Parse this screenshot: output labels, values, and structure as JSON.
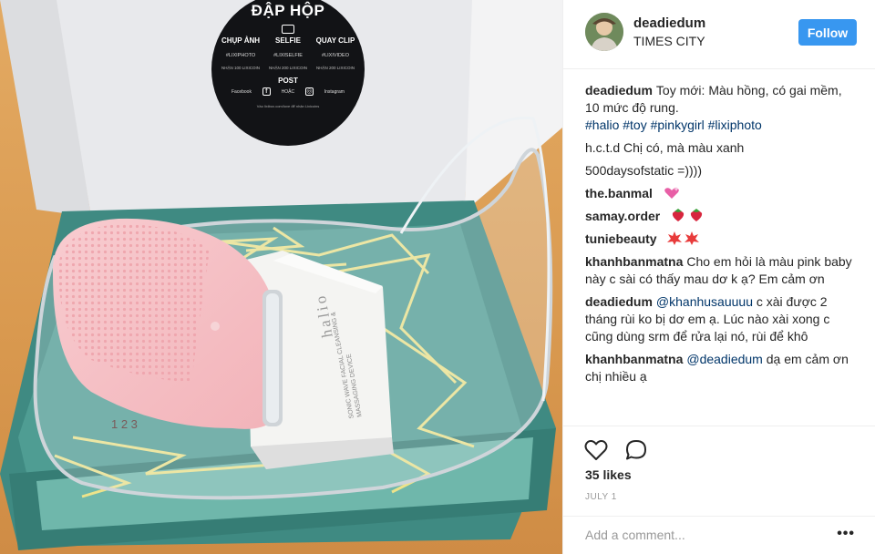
{
  "post": {
    "image_alt": "Halio sonic facial cleansing device in a Lixibox gift box",
    "sticker": {
      "title": "ĐẬP HỘP",
      "columns": [
        {
          "heading": "CHỤP ẢNH",
          "tag": "#LIXIPHOTO",
          "reward": "NHẬN 100 LIXICOIN"
        },
        {
          "heading": "SELFIE",
          "tag": "#LIXISELFIE",
          "reward": "NHẬN 200 LIXICOIN"
        },
        {
          "heading": "QUAY CLIP",
          "tag": "#LIXIVIDEO",
          "reward": "NHẬN 200 LIXICOIN"
        }
      ],
      "post_label": "POST",
      "channels": [
        "Facebook",
        "HOẶC",
        "Instagram"
      ],
      "fine_print": "Vào lixibox.com/love để nhận Lixicoins"
    },
    "device": {
      "brand": "halio",
      "subtitle": "SONIC WAVE FACIAL CLEANSING & MASSAGING DEVICE"
    }
  },
  "header": {
    "username": "deadiedum",
    "location": "TIMES CITY",
    "follow_label": "Follow"
  },
  "comments": [
    {
      "user": "deadiedum",
      "text": "Toy mới: Màu hồng, có gai mềm, 10 mức độ rung.",
      "tags": "#halio #toy #pinkygirl #lixiphoto",
      "emoji": ""
    },
    {
      "user": "",
      "text": "h.c.t.d Chị có, mà màu xanh",
      "tags": "",
      "emoji": ""
    },
    {
      "user": "",
      "text": "500daysofstatic =))))",
      "tags": "",
      "emoji": ""
    },
    {
      "user": "the.banmal",
      "text": "",
      "tags": "",
      "emoji": "heart"
    },
    {
      "user": "samay.order",
      "text": "",
      "tags": "",
      "emoji": "strawberry"
    },
    {
      "user": "tuniebeauty",
      "text": "",
      "tags": "",
      "emoji": "burst"
    },
    {
      "user": "khanhbanmatna",
      "text": "Cho em hỏi là màu pink baby này c sài có thấy mau dơ k ạ? Em cảm ơn",
      "tags": "",
      "emoji": ""
    },
    {
      "user": "deadiedum",
      "text": "c xài được 2 tháng rùi ko bị dơ em ạ. Lúc nào xài xong c cũng dùng srm để rửa lại nó, rùi để khô",
      "tags": "@khanhusauuuu",
      "emoji": ""
    },
    {
      "user": "khanhbanmatna",
      "text": "dạ em cảm ơn chị nhiều ạ",
      "tags": "@deadiedum",
      "emoji": ""
    }
  ],
  "likes": "35 likes",
  "date": "JULY 1",
  "add_comment": {
    "placeholder": "Add a comment..."
  },
  "more_label": "•••",
  "icons": [
    "heart-icon",
    "comment-icon",
    "more-options-icon"
  ],
  "colors": {
    "follow": "#3897f0",
    "link": "#003569",
    "text": "#262626",
    "muted": "#999999"
  }
}
